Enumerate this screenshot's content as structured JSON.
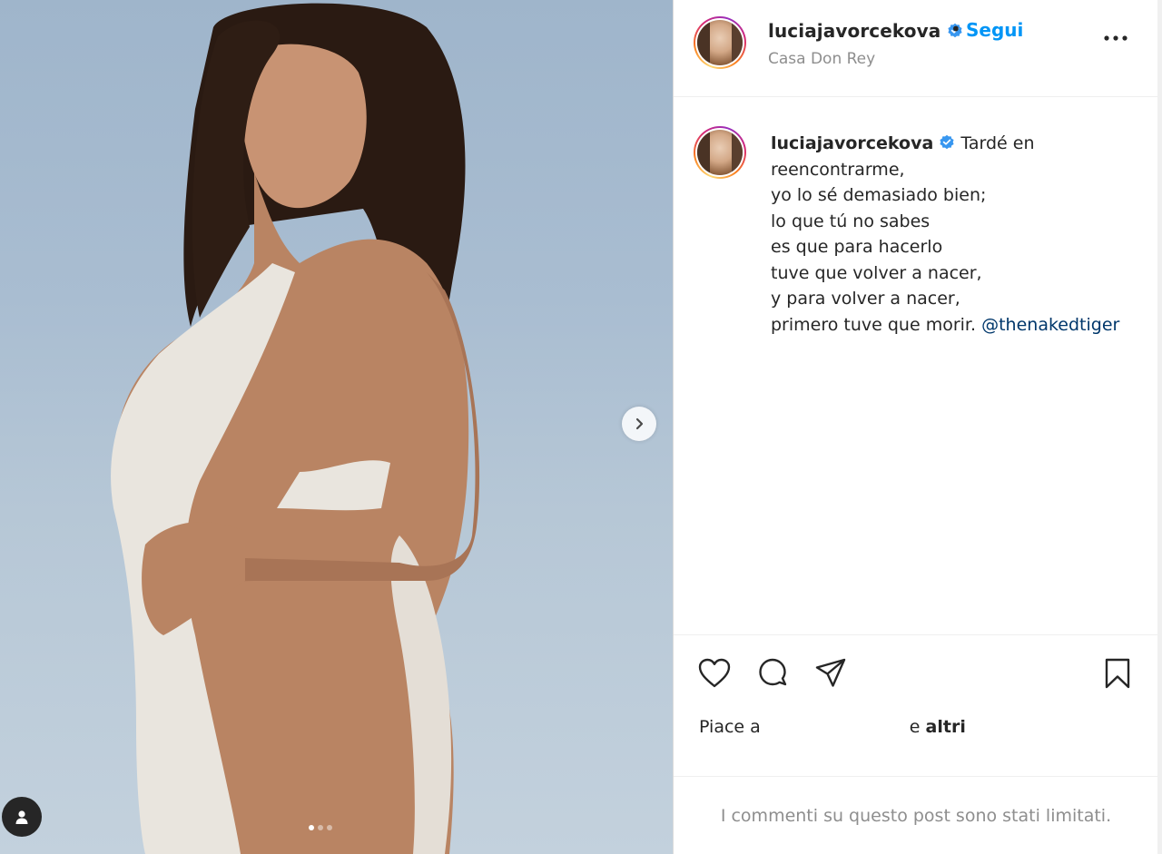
{
  "header": {
    "username": "luciajavorcekova",
    "separator": "•",
    "follow_label": "Segui",
    "location": "Casa Don Rey",
    "more_icon": "more-horizontal-icon"
  },
  "caption": {
    "username": "luciajavorcekova",
    "lines": [
      "Tardé en",
      "reencontrarme,",
      "yo lo sé demasiado bien;",
      "lo que tú no sabes",
      "es que para hacerlo",
      "tuve que volver a nacer,",
      "y para volver a nacer,",
      "primero tuve que morir."
    ],
    "mention": "@thenakedtiger"
  },
  "actions": {
    "icons": [
      "heart-icon",
      "comment-icon",
      "share-icon",
      "bookmark-icon"
    ],
    "likes_prefix": "Piace a",
    "likes_joiner": "e",
    "likes_others": "altri"
  },
  "comments_notice": "I commenti su questo post sono stati limitati.",
  "media": {
    "carousel_count": 3,
    "carousel_active": 1,
    "icons": [
      "chevron-right-icon",
      "user-tag-icon"
    ]
  },
  "colors": {
    "accent": "#0095f6",
    "verified": "#3897f0",
    "mention": "#00376b",
    "muted": "#8e8e8e"
  }
}
